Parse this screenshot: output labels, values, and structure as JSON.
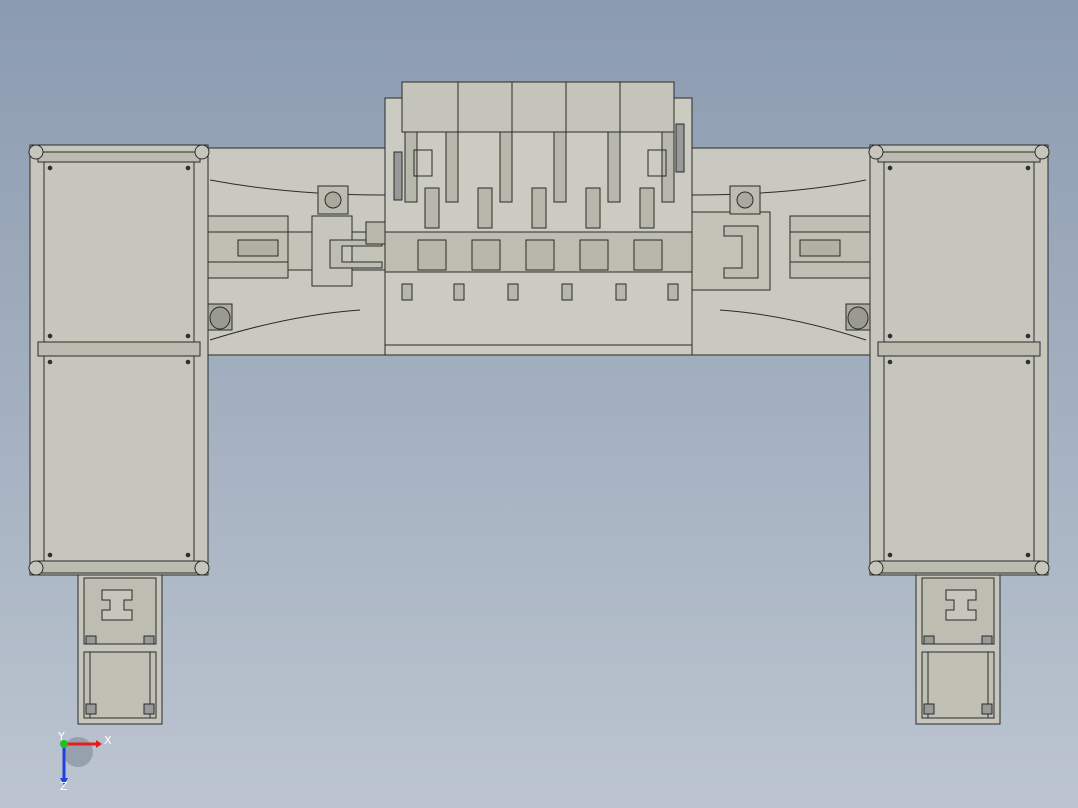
{
  "viewport": {
    "background_top": "#8b9bb0",
    "background_bottom": "#bcc5d0",
    "model_fill": "#c6c6bc",
    "model_fill_dark": "#b4b4a8",
    "edge_color": "#2b2b2b"
  },
  "triad": {
    "x_label": "X",
    "y_label": "Y",
    "z_label": "Z",
    "x_color": "#e02020",
    "y_color": "#20c020",
    "z_color": "#2040e0"
  }
}
